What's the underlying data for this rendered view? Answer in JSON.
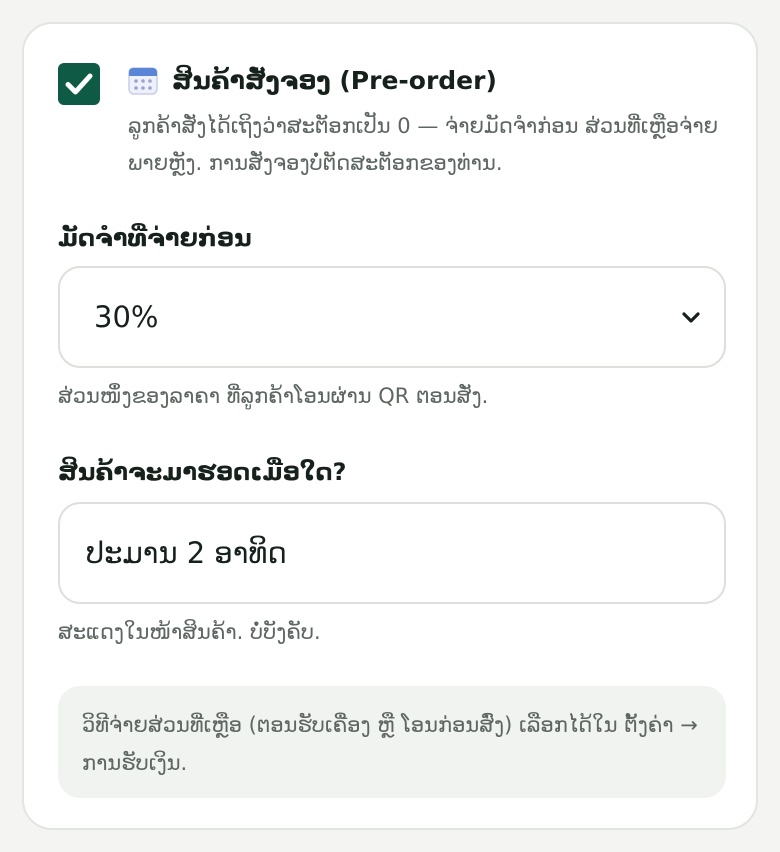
{
  "preorder": {
    "checked": true,
    "icon": "calendar-icon",
    "title": "ສິນຄ້າສັ່ງຈອງ (Pre-order)",
    "description": "ລູກຄ້າສັ່ງໄດ້ເຖິງວ່າສະຕັອກເປັນ 0 — ຈ່າຍມັດຈຳກ່ອນ ສ່ວນທີ່ເຫຼືອຈ່າຍພາຍຫຼັງ. ການສັ່ງຈອງບໍ່ຕັດສະຕັອກຂອງທ່ານ."
  },
  "deposit": {
    "label": "ມັດຈຳທີ່ຈ່າຍກ່ອນ",
    "selected": "30%",
    "help": "ສ່ວນໜຶ່ງຂອງລາຄາ ທີ່ລູກຄ້າໂອນຜ່ານ QR ຕອນສັ່ງ."
  },
  "arrival": {
    "label": "ສິນຄ້າຈະມາຮອດເມື່ອໃດ?",
    "value": "ປະມານ 2 ອາທິດ",
    "help": "ສະແດງໃນໜ້າສິນຄ້າ. ບໍ່ບັງຄັບ."
  },
  "note": {
    "text": "ວິທີຈ່າຍສ່ວນທີ່ເຫຼືອ (ຕອນຮັບເຄື່ອງ ຫຼື ໂອນກ່ອນສົ່ງ) ເລືອກໄດ້ໃນ ຕັ້ງຄ່າ → ການຮັບເງິນ."
  },
  "colors": {
    "accent": "#0f5a44",
    "card_border": "#e2e5e1",
    "muted_text": "#5d6661",
    "note_bg": "#f1f3f0"
  }
}
